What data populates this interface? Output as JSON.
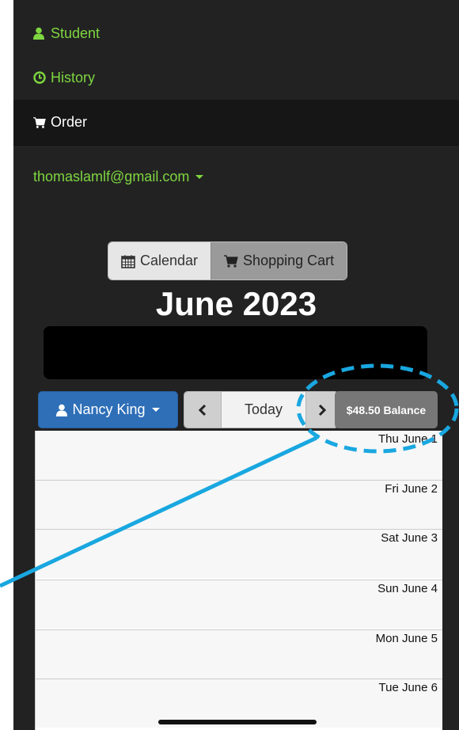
{
  "nav": {
    "student": "Student",
    "history": "History",
    "order": "Order",
    "user_email": "thomaslamlf@gmail.com"
  },
  "toolbar": {
    "calendar_label": "Calendar",
    "cart_label": "Shopping Cart"
  },
  "month_title": "June 2023",
  "controls": {
    "student_name": "Nancy King",
    "today_label": "Today",
    "balance_label": "$48.50 Balance"
  },
  "days": [
    {
      "label": "Thu June 1"
    },
    {
      "label": "Fri June 2"
    },
    {
      "label": "Sat June 3"
    },
    {
      "label": "Sun June 4"
    },
    {
      "label": "Mon June 5"
    },
    {
      "label": "Tue June 6"
    }
  ],
  "colors": {
    "nav_green": "#7ed640",
    "primary_blue": "#2e6fb8",
    "annotation_blue": "#19a7e0",
    "background": "#222222"
  }
}
